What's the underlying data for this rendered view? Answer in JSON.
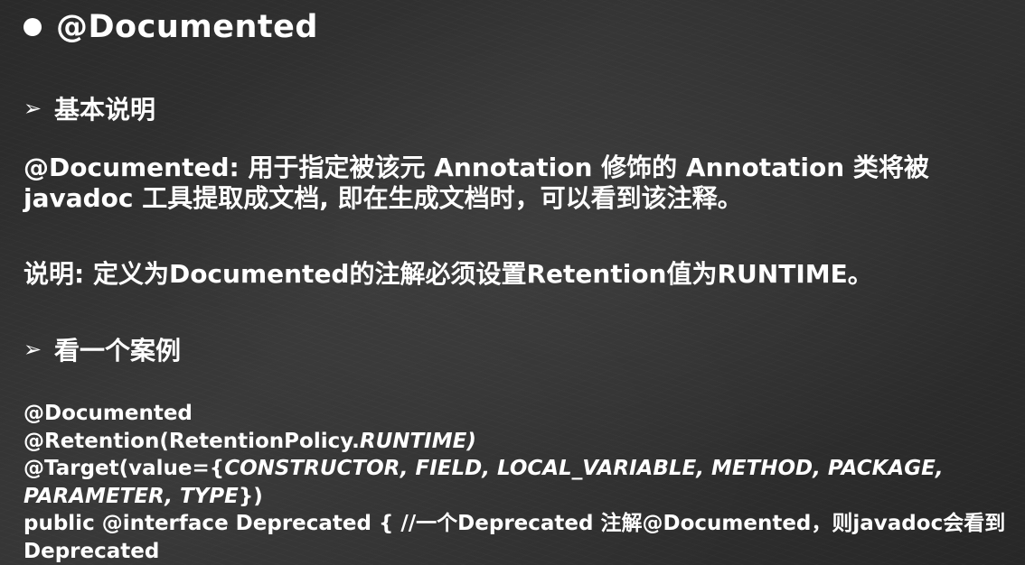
{
  "title": "@Documented",
  "sections": {
    "basic": {
      "heading_arrow": "➢",
      "heading": "基本说明",
      "para1_line1": "@Documented: 用于指定被该元 Annotation 修饰的 Annotation 类将被",
      "para1_line2": "javadoc 工具提取成文档, 即在生成文档时，可以看到该注释。",
      "para2": "说明: 定义为Documented的注解必须设置Retention值为RUNTIME。"
    },
    "example": {
      "heading_arrow": "➢",
      "heading": "看一个案例"
    }
  },
  "code": {
    "l1": "@Documented",
    "l2_prefix": "@Retention(RetentionPolicy.",
    "l2_italic": "RUNTIME)",
    "l3_prefix": "@Target(value={",
    "l3_italic": "CONSTRUCTOR, FIELD, LOCAL_VARIABLE, METHOD, PACKAGE,",
    "l4_italic": "PARAMETER, TYPE",
    "l4_suffix": "})",
    "l5": "public @interface Deprecated { //一个Deprecated 注解@Documented，则javadoc会看到",
    "l6": "Deprecated"
  },
  "colors": {
    "background": "#2f2f2f",
    "text": "#ffffff"
  }
}
